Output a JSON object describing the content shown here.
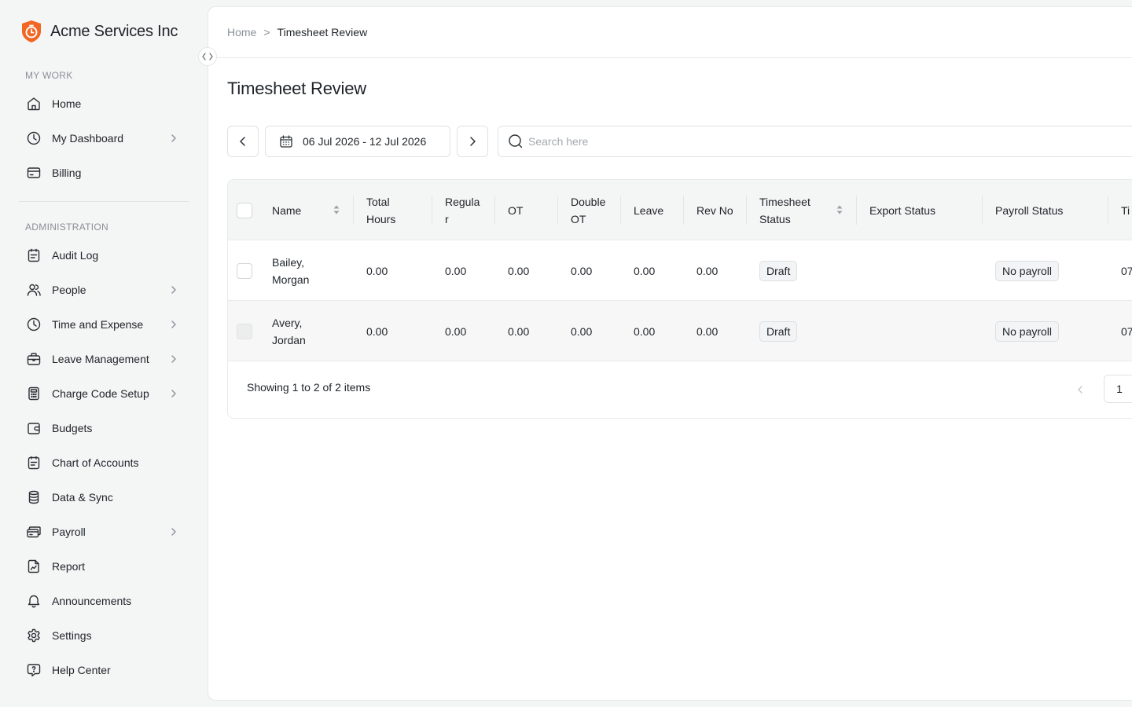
{
  "brand": {
    "name": "Acme Services Inc",
    "color": "#f26522"
  },
  "sidebar": {
    "sections": [
      {
        "title": "MY WORK"
      },
      {
        "title": "ADMINISTRATION"
      }
    ],
    "items": [
      {
        "label": "Home",
        "icon": "home-icon",
        "has_children": false
      },
      {
        "label": "My Dashboard",
        "icon": "clock-icon",
        "has_children": true
      },
      {
        "label": "Billing",
        "icon": "credit-card-icon",
        "has_children": false
      },
      {
        "label": "Audit Log",
        "icon": "clipboard-icon",
        "has_children": false
      },
      {
        "label": "People",
        "icon": "users-icon",
        "has_children": true
      },
      {
        "label": "Time and Expense",
        "icon": "clock-icon",
        "has_children": true
      },
      {
        "label": "Leave Management",
        "icon": "briefcase-icon",
        "has_children": true
      },
      {
        "label": "Charge Code Setup",
        "icon": "calculator-icon",
        "has_children": true
      },
      {
        "label": "Budgets",
        "icon": "wallet-icon",
        "has_children": false
      },
      {
        "label": "Chart of Accounts",
        "icon": "clipboard-list-icon",
        "has_children": false
      },
      {
        "label": "Data & Sync",
        "icon": "database-icon",
        "has_children": false
      },
      {
        "label": "Payroll",
        "icon": "payroll-icon",
        "has_children": true
      },
      {
        "label": "Report",
        "icon": "report-icon",
        "has_children": false
      },
      {
        "label": "Announcements",
        "icon": "bell-icon",
        "has_children": false
      },
      {
        "label": "Settings",
        "icon": "gear-icon",
        "has_children": false
      },
      {
        "label": "Help Center",
        "icon": "help-icon",
        "has_children": false
      }
    ]
  },
  "breadcrumb": {
    "home": "Home",
    "separator": ">",
    "current": "Timesheet Review"
  },
  "page": {
    "title": "Timesheet Review"
  },
  "toolbar": {
    "date_range": "06 Jul 2026 - 12 Jul 2026",
    "search_placeholder": "Search here"
  },
  "table": {
    "columns": [
      {
        "label": "Name",
        "sortable": true
      },
      {
        "label": "Total Hours",
        "sortable": false
      },
      {
        "label": "Regular",
        "sortable": false
      },
      {
        "label": "OT",
        "sortable": false
      },
      {
        "label": "Double OT",
        "sortable": false
      },
      {
        "label": "Leave",
        "sortable": false
      },
      {
        "label": "Rev No",
        "sortable": false
      },
      {
        "label": "Timesheet Status",
        "sortable": true
      },
      {
        "label": "Export Status",
        "sortable": false
      },
      {
        "label": "Payroll Status",
        "sortable": false
      },
      {
        "label": "Ti",
        "sortable": false
      }
    ],
    "rows": [
      {
        "name": "Bailey, Morgan",
        "total_hours": "0.00",
        "regular": "0.00",
        "ot": "0.00",
        "double_ot": "0.00",
        "leave": "0.00",
        "rev_no": "0.00",
        "timesheet_status": "Draft",
        "export_status": "",
        "payroll_status": "No payroll",
        "time": "07",
        "checkbox_disabled": false
      },
      {
        "name": "Avery, Jordan",
        "total_hours": "0.00",
        "regular": "0.00",
        "ot": "0.00",
        "double_ot": "0.00",
        "leave": "0.00",
        "rev_no": "0.00",
        "timesheet_status": "Draft",
        "export_status": "",
        "payroll_status": "No payroll",
        "time": "07",
        "checkbox_disabled": true
      }
    ],
    "footer": {
      "summary": "Showing 1 to 2 of 2 items",
      "current_page": "1"
    }
  }
}
